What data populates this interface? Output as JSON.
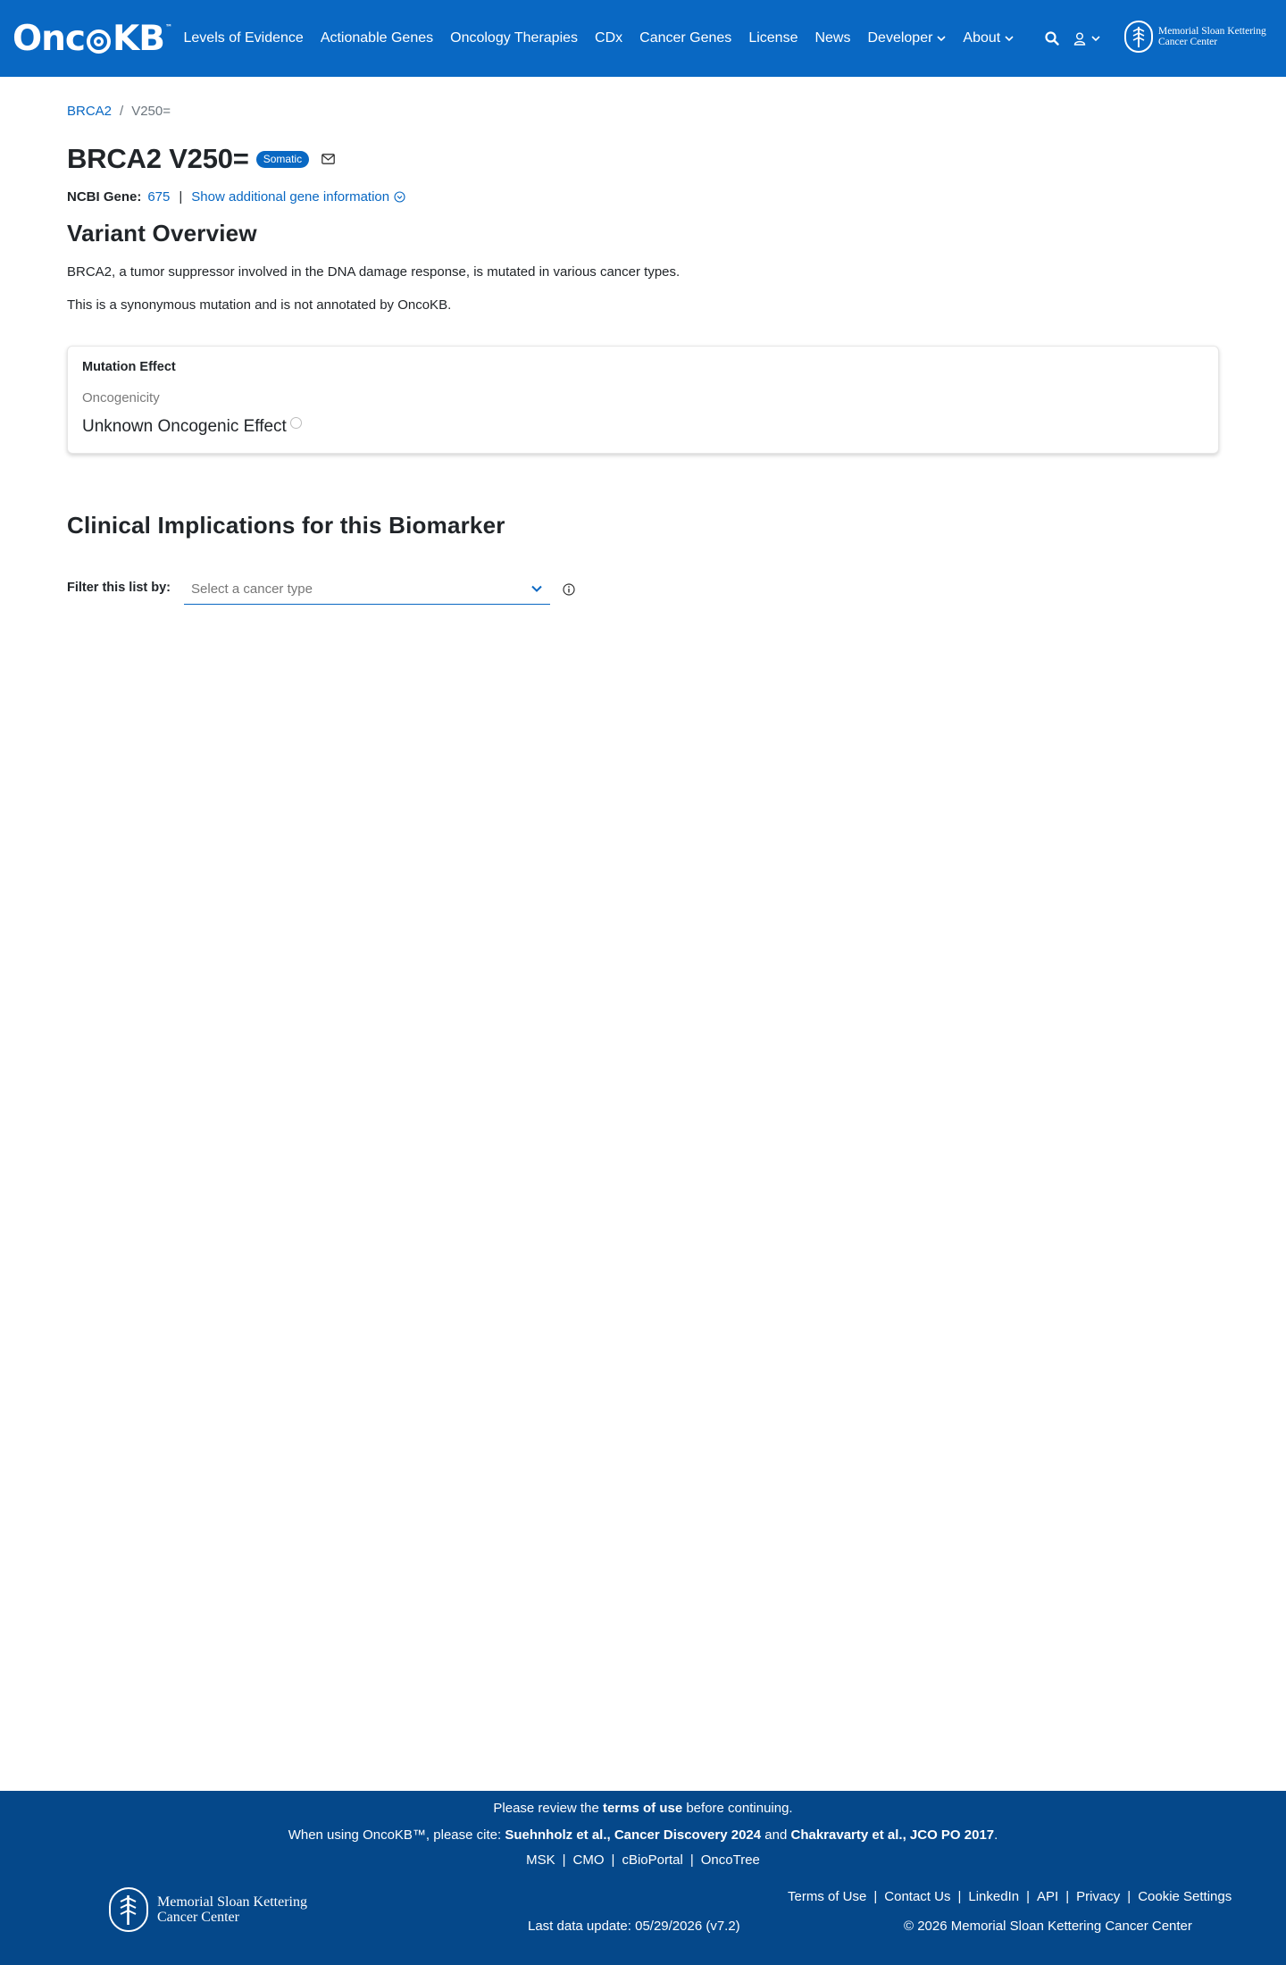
{
  "header": {
    "brand_pre": "Onc",
    "brand_post": "KB",
    "brand_tm": "™",
    "nav": [
      {
        "label": "Levels of Evidence"
      },
      {
        "label": "Actionable Genes"
      },
      {
        "label": "Oncology Therapies"
      },
      {
        "label": "CDx"
      },
      {
        "label": "Cancer Genes"
      },
      {
        "label": "License"
      },
      {
        "label": "News"
      },
      {
        "label": "Developer"
      },
      {
        "label": "About"
      }
    ],
    "msk_line1": "Memorial Sloan Kettering",
    "msk_line2": "Cancer Center",
    "icons": [
      "search-icon",
      "user-icon",
      "chevron-down-icon",
      "msk-logo-icon"
    ]
  },
  "breadcrumb": {
    "gene": "BRCA2",
    "separator": "/",
    "current": "V250="
  },
  "title": {
    "text": "BRCA2 V250=",
    "badge": "Somatic"
  },
  "gene_info": {
    "label": "NCBI Gene:",
    "value": "675",
    "separator": "|",
    "more": "Show additional gene information"
  },
  "overview": {
    "title": "Variant Overview",
    "summary": "BRCA2, a tumor suppressor involved in the DNA damage response, is mutated in various cancer types.",
    "note": "This is a synonymous mutation and is not annotated by OncoKB."
  },
  "mutation_effect": {
    "label": "Mutation Effect",
    "sub_label": "Oncogenicity",
    "value": "Unknown Oncogenic Effect"
  },
  "clinical": {
    "title": "Clinical Implications for this Biomarker",
    "filter_label": "Filter this list by:",
    "filter_placeholder": "Select a cancer type"
  },
  "footer": {
    "review_pre": "Please review the",
    "review_link": "terms of use",
    "review_post": "before continuing.",
    "cite_pre": "When using OncoKB™, please cite:",
    "cite_1": "Suehnholz et al., Cancer Discovery 2024",
    "cite_and": "and",
    "cite_2": "Chakravarty et al., JCO PO 2017",
    "cite_end": ".",
    "links": [
      "MSK",
      "CMO",
      "cBioPortal",
      "OncoTree"
    ],
    "right_links": [
      "Terms of Use",
      "Contact Us",
      "LinkedIn",
      "API",
      "Privacy",
      "Cookie Settings"
    ],
    "last_update": "Last data update: 05/29/2026 (v7.2)",
    "copyright": "© 2026 Memorial Sloan Kettering Cancer Center",
    "msk_line1": "Memorial Sloan Kettering",
    "msk_line2": "Cancer Center",
    "link_separator": "|"
  },
  "colors": {
    "brand_blue": "#0968c3",
    "footer_blue": "#05488a"
  }
}
